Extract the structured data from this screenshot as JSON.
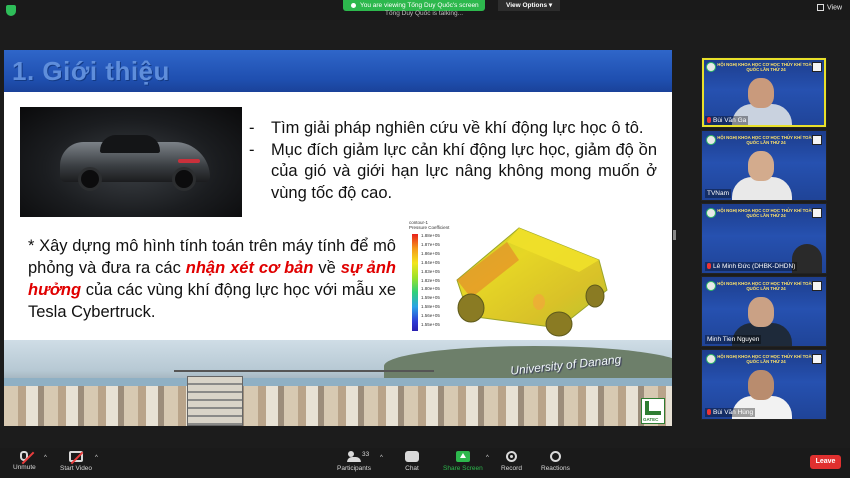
{
  "top_bar": {
    "viewing_text": "You are viewing Tống Duy Quốc's screen",
    "view_options": "View Options",
    "talking_text": "Tống Duy Quốc is talking...",
    "view_label": "View"
  },
  "slide": {
    "title": "1. Giới thiệu",
    "bullets": [
      "Tìm giải pháp nghiên cứu về khí động lực học ô tô.",
      "Mục đích giảm lực cản khí động lực học, giảm độ ồn của gió và giới hạn lực nâng không mong muốn ở vùng tốc độ cao."
    ],
    "bullet_marker": "-",
    "paragraph": {
      "p1": "* Xây dựng mô hình tính toán trên máy tính để mô phỏng và đưa ra các ",
      "red1": "nhận xét cơ bản",
      "p2": " về ",
      "red2": "sự ảnh hưởng",
      "p3": " của các vùng khí động lực học với mẫu xe Tesla Cybertruck."
    },
    "legend": {
      "title_line1": "contour-1",
      "title_line2": "Pressure Coefficient",
      "ticks": [
        "1.88e+05",
        "1.87e+05",
        "1.86e+05",
        "1.84e+05",
        "1.83e+05",
        "1.82e+05",
        "1.80e+05",
        "1.59e+05",
        "1.58e+05",
        "1.56e+05",
        "1.55e+05"
      ]
    },
    "watermark": "University of Danang",
    "logo_text": "GATEC"
  },
  "banner_text": "HỘI NGHỊ KHOA HỌC CƠ HỌC THỦY KHÍ TOÀN QUỐC LẦN THỨ 24",
  "participants": [
    {
      "name": "Bùi Văn Ga",
      "muted": true,
      "active": true
    },
    {
      "name": "TVNam",
      "muted": false,
      "active": false
    },
    {
      "name": "Lê Minh Đức (DHBK-DHDN)",
      "muted": true,
      "active": false
    },
    {
      "name": "Minh Tien Nguyen",
      "muted": false,
      "active": false
    },
    {
      "name": "Bùi Văn Hùng",
      "muted": true,
      "active": false
    }
  ],
  "toolbar": {
    "unmute": "Unmute",
    "start_video": "Start Video",
    "participants": "Participants",
    "participants_count": "33",
    "chat": "Chat",
    "share_screen": "Share Screen",
    "record": "Record",
    "reactions": "Reactions",
    "leave": "Leave"
  },
  "colors": {
    "share_green": "#2db84d",
    "leave_red": "#e0302f",
    "emphasis_red": "#e00000",
    "slide_header_blue": "#1f4fb0"
  }
}
